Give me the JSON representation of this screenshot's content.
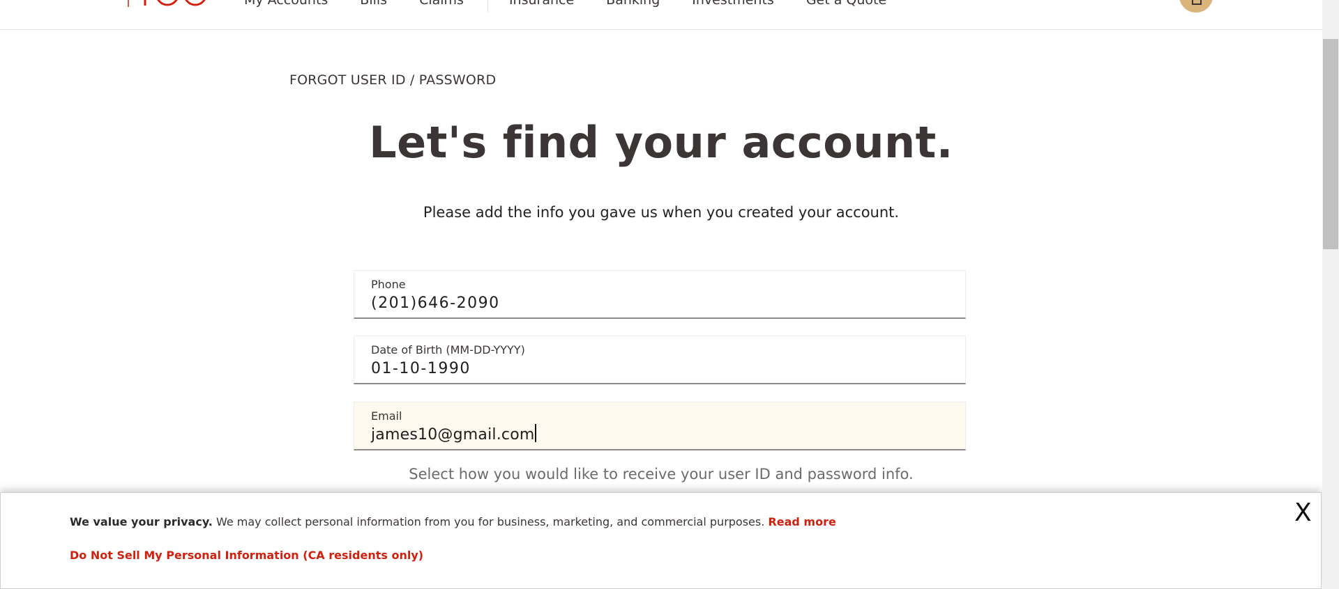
{
  "nav": {
    "items": [
      "My Accounts",
      "Bills",
      "Claims",
      "Insurance",
      "Banking",
      "Investments",
      "Get a Quote"
    ]
  },
  "breadcrumb": "FORGOT USER ID / PASSWORD",
  "title": "Let's find your account.",
  "subtitle": "Please add the info you gave us when you created your account.",
  "form": {
    "phone": {
      "label": "Phone",
      "value": "(201)646-2090"
    },
    "dob": {
      "label": "Date of Birth (MM-DD-YYYY)",
      "value": "01-10-1990"
    },
    "email": {
      "label": "Email",
      "value": "james10@gmail.com"
    }
  },
  "instructions": "Select how you would like to receive your user ID and password info.",
  "privacy": {
    "heading": "We value your privacy.",
    "text": " We may collect personal information from you for business, marketing, and commercial purposes. ",
    "read_more": "Read more",
    "do_not_sell": "Do Not Sell My Personal Information (CA residents only)",
    "close": "X"
  },
  "colors": {
    "brand_red": "#d0210f",
    "text": "#3b3535",
    "avatar": "#d9b57c"
  }
}
